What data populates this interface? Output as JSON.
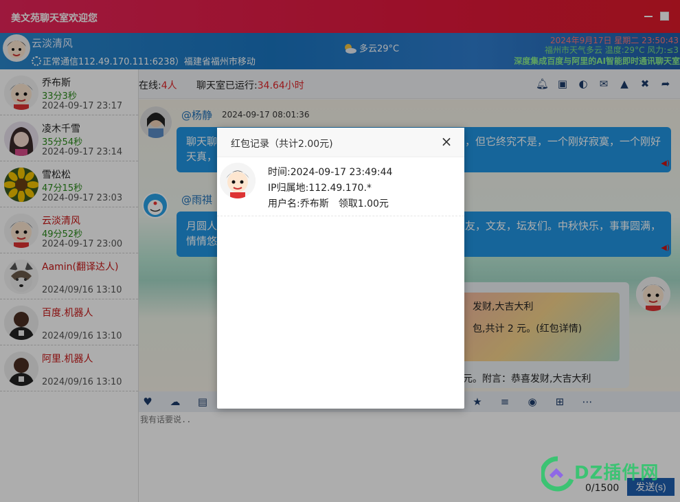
{
  "window": {
    "title": "美文苑聊天室欢迎您"
  },
  "header": {
    "username": "云淡清风",
    "connection": "正常通信112.49.170.111:6238）福建省福州市移动",
    "weather": "多云29°C",
    "ticker_top": "2024年9月17日 星期二 23:50:43",
    "ticker_mid": "福州市天气多云 温度:29°C 风力:≤3",
    "ticker_bottom": "深度集成百度与阿里的AI智能即时通讯聊天室"
  },
  "sidebar": {
    "users": [
      {
        "name": "乔布斯",
        "duration": "33分3秒",
        "time": "2024-09-17 23:17",
        "red": false,
        "avatar": "cartoon-boy"
      },
      {
        "name": "凌木千雪",
        "duration": "35分54秒",
        "time": "2024-09-17 23:14",
        "red": false,
        "avatar": "girl"
      },
      {
        "name": "雪松松",
        "duration": "47分15秒",
        "time": "2024-09-17 23:03",
        "red": false,
        "avatar": "sunflower"
      },
      {
        "name": "云淡清风",
        "duration": "49分52秒",
        "time": "2024-09-17 23:00",
        "red": true,
        "avatar": "cartoon-boy"
      },
      {
        "name": "Aamin(翻译达人)",
        "duration": "",
        "time": "2024/09/16 13:10",
        "red": true,
        "avatar": "husky"
      },
      {
        "name": "百度.机器人",
        "duration": "",
        "time": "2024/09/16 13:10",
        "red": true,
        "avatar": "robot"
      },
      {
        "name": "阿里.机器人",
        "duration": "",
        "time": "2024/09/16 13:10",
        "red": true,
        "avatar": "robot"
      }
    ]
  },
  "status": {
    "online_label": "在线:",
    "online_count": "4人",
    "running_label": "聊天室已运行:",
    "running_hours": "34.64小时"
  },
  "messages": [
    {
      "name": "@杨静",
      "time": "2024-09-17 08:01:36",
      "text_left": "聊天聊",
      "text_right": "，但它终究不是，一个刚好寂寞，一个刚好",
      "text_line2": "天真，"
    },
    {
      "name": "@雨祺",
      "text_left": "月圆人",
      "text_right": "友，文友，坛友们。中秋快乐，事事圆满，",
      "text_line2": "情情悠"
    }
  ],
  "redpacket_card": {
    "line1": "发财,大吉大利",
    "line2": "包,共计 2 元。(红包详情)",
    "footer": "元。附言：恭喜发财,大吉大利"
  },
  "input": {
    "placeholder": "我有话要说..",
    "counter": "0/1500",
    "send_label": "发送(s)"
  },
  "modal": {
    "title": "红包记录（共计2.00元)",
    "close": "×",
    "record": {
      "time": "时间:2024-09-17 23:49:44",
      "ip": "IP归属地:112.49.170.*",
      "user": "用户名:乔布斯　领取1.00元"
    }
  },
  "watermark": {
    "text": "DZ插件网"
  }
}
